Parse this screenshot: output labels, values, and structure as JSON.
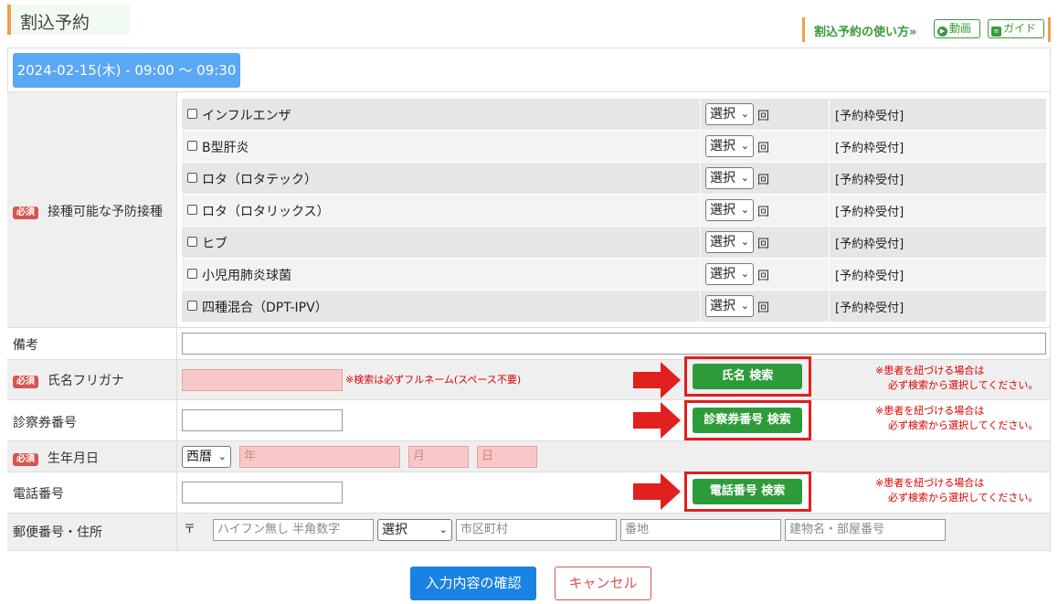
{
  "page_title": "割込予約",
  "help": {
    "text": "割込予約の使い方»",
    "video_label": "動画",
    "guide_label": "ガイド"
  },
  "date_button": "2024-02-15(木) - 09:00 〜 09:30",
  "required_badge": "必須",
  "vaccines": {
    "label": "接種可能な予防接種",
    "select_value": "選択",
    "count_unit": "回",
    "status": "[予約枠受付]",
    "items": [
      {
        "name": "インフルエンザ"
      },
      {
        "name": "B型肝炎"
      },
      {
        "name": "ロタ（ロタテック）"
      },
      {
        "name": "ロタ（ロタリックス）"
      },
      {
        "name": "ヒブ"
      },
      {
        "name": "小児用肺炎球菌"
      },
      {
        "name": "四種混合（DPT-IPV）"
      }
    ]
  },
  "remarks": {
    "label": "備考",
    "value": ""
  },
  "furigana": {
    "label": "氏名フリガナ",
    "value": "",
    "note": "※検索は必ずフルネーム(スペース不要)",
    "search_label": "氏名 検索"
  },
  "card_number": {
    "label": "診察券番号",
    "value": "",
    "search_label": "診察券番号 検索"
  },
  "birthdate": {
    "label": "生年月日",
    "era_value": "西暦",
    "year_placeholder": "年",
    "month_placeholder": "月",
    "day_placeholder": "日"
  },
  "phone": {
    "label": "電話番号",
    "value": "",
    "search_label": "電話番号 検索"
  },
  "link_note": {
    "line1": "※患者を紐づける場合は",
    "line2": "必ず検索から選択してください。"
  },
  "address": {
    "label": "郵便番号・住所",
    "postal_mark": "〒",
    "postal_placeholder": "ハイフン無し 半角数字",
    "prefecture_value": "選択",
    "city_placeholder": "市区町村",
    "number_placeholder": "番地",
    "building_placeholder": "建物名・部屋番号"
  },
  "actions": {
    "confirm_label": "入力内容の確認",
    "cancel_label": "キャンセル"
  },
  "colors": {
    "accent_orange": "#f0a04a",
    "date_blue": "#5aa7f5",
    "search_green": "#2e9b3a",
    "highlight_red": "#e01f1f",
    "confirm_blue": "#1a82e2",
    "required_red": "#d9534f"
  }
}
